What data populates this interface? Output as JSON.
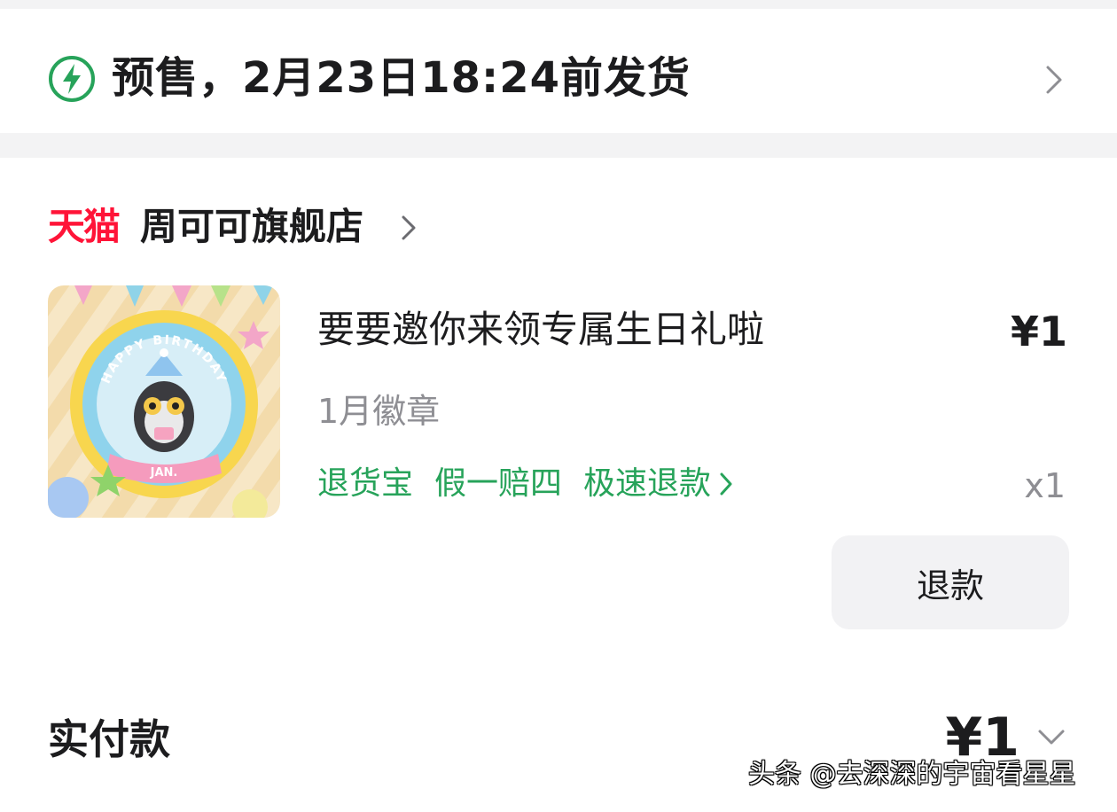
{
  "shipping": {
    "icon": "lightning-icon",
    "text": "预售，2月23日18:24前发货"
  },
  "store": {
    "platform_badge": "天猫",
    "name": "周可可旗舰店"
  },
  "product": {
    "image_text_top": "HAPPY BIRTHDAY",
    "image_text_ribbon": "JAN.",
    "title": "要要邀你来领专属生日礼啦",
    "price": "¥1",
    "spec": "1月徽章",
    "tags": [
      "退货宝",
      "假一赔四",
      "极速退款"
    ],
    "quantity": "x1"
  },
  "actions": {
    "refund_label": "退款"
  },
  "payment": {
    "label": "实付款",
    "amount": "¥1"
  },
  "watermark": "头条 @去深深的宇宙看星星",
  "colors": {
    "accent_green": "#27a35a",
    "tmall_red": "#ff1438",
    "text_primary": "#1c1c1e",
    "text_secondary": "#8e8e93"
  }
}
